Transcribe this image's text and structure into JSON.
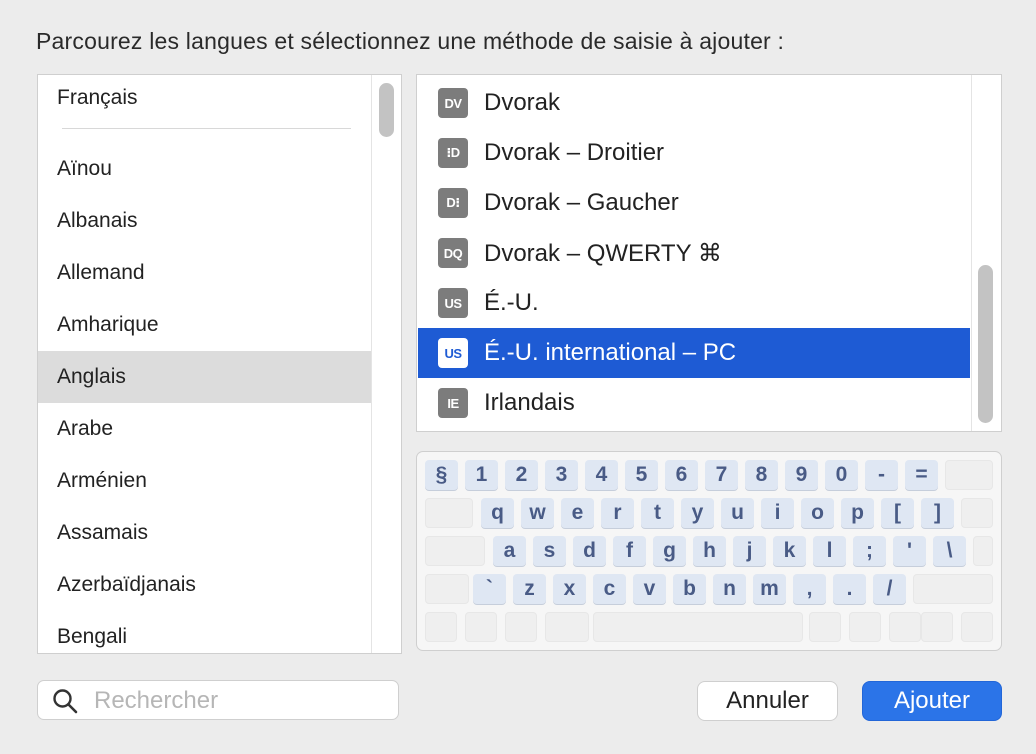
{
  "dialog": {
    "title": "Parcourez les langues et sélectionnez une méthode de saisie à ajouter :"
  },
  "languages": {
    "pinned": "Français",
    "items": [
      "Aïnou",
      "Albanais",
      "Allemand",
      "Amharique",
      "Anglais",
      "Arabe",
      "Arménien",
      "Assamais",
      "Azerbaïdjanais",
      "Bengali"
    ],
    "selected": "Anglais"
  },
  "input_methods": {
    "items": [
      {
        "badge": "DV",
        "label": "Dvorak"
      },
      {
        "badge": "⁝D",
        "label": "Dvorak – Droitier"
      },
      {
        "badge": "D⁝",
        "label": "Dvorak – Gaucher"
      },
      {
        "badge": "DQ",
        "label": "Dvorak – QWERTY ⌘"
      },
      {
        "badge": "US",
        "label": "É.-U."
      },
      {
        "badge": "US",
        "label": "É.-U. international – PC"
      },
      {
        "badge": "IE",
        "label": "Irlandais"
      }
    ],
    "selected": "É.-U. international – PC"
  },
  "keyboard": {
    "row1": [
      "§",
      "1",
      "2",
      "3",
      "4",
      "5",
      "6",
      "7",
      "8",
      "9",
      "0",
      "-",
      "="
    ],
    "row2": [
      "q",
      "w",
      "e",
      "r",
      "t",
      "y",
      "u",
      "i",
      "o",
      "p",
      "[",
      "]"
    ],
    "row3": [
      "a",
      "s",
      "d",
      "f",
      "g",
      "h",
      "j",
      "k",
      "l",
      ";",
      "'",
      "\\"
    ],
    "row4": [
      "`",
      "z",
      "x",
      "c",
      "v",
      "b",
      "n",
      "m",
      ",",
      ".",
      "/"
    ]
  },
  "search": {
    "placeholder": "Rechercher",
    "value": ""
  },
  "buttons": {
    "cancel": "Annuler",
    "add": "Ajouter"
  },
  "colors": {
    "accent": "#2b74e8",
    "selection": "#1e5bd4",
    "key_text": "#495b86"
  }
}
